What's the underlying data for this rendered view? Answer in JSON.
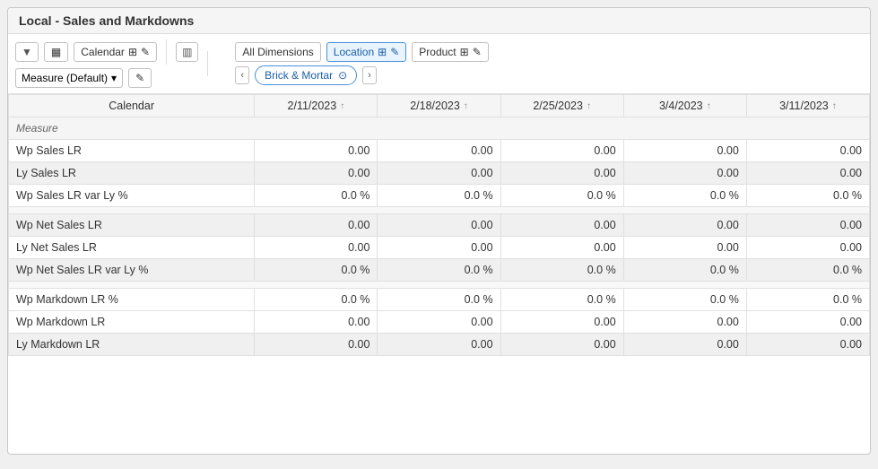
{
  "window": {
    "title": "Local - Sales and Markdowns"
  },
  "toolbar": {
    "collapse_label": "▼",
    "rows_icon_label": "☰",
    "calendar_label": "Calendar",
    "hierarchy_icon": "⊞",
    "edit_icon": "✎",
    "measure_label": "Measure (Default)",
    "dropdown_arrow": "▾",
    "all_dimensions_label": "All Dimensions",
    "location_label": "Location",
    "product_label": "Product",
    "brick_mortar_label": "Brick & Mortar",
    "nav_left": "‹",
    "nav_right": "›",
    "target_icon": "⊙",
    "rows_toggle": "▥"
  },
  "table": {
    "calendar_label": "Calendar",
    "measure_label": "Measure",
    "columns": [
      {
        "date": "2/11/2023"
      },
      {
        "date": "2/18/2023"
      },
      {
        "date": "2/25/2023"
      },
      {
        "date": "3/4/2023"
      },
      {
        "date": "3/11/2023"
      }
    ],
    "rows": [
      {
        "label": "Measure",
        "is_header": true,
        "values": [
          "",
          "",
          "",
          "",
          ""
        ]
      },
      {
        "label": "Wp Sales LR",
        "shaded": false,
        "values": [
          "0.00",
          "0.00",
          "0.00",
          "0.00",
          "0.00"
        ]
      },
      {
        "label": "Ly Sales LR",
        "shaded": true,
        "values": [
          "0.00",
          "0.00",
          "0.00",
          "0.00",
          "0.00"
        ]
      },
      {
        "label": "Wp Sales LR var Ly %",
        "shaded": false,
        "values": [
          "0.0 %",
          "0.0 %",
          "0.0 %",
          "0.0 %",
          "0.0 %"
        ]
      },
      {
        "label": "",
        "is_spacer": true,
        "shaded": false,
        "values": [
          "",
          "",
          "",
          "",
          ""
        ]
      },
      {
        "label": "Wp Net Sales LR",
        "shaded": true,
        "values": [
          "0.00",
          "0.00",
          "0.00",
          "0.00",
          "0.00"
        ]
      },
      {
        "label": "Ly Net Sales LR",
        "shaded": false,
        "values": [
          "0.00",
          "0.00",
          "0.00",
          "0.00",
          "0.00"
        ]
      },
      {
        "label": "Wp Net Sales LR var Ly %",
        "shaded": true,
        "values": [
          "0.0 %",
          "0.0 %",
          "0.0 %",
          "0.0 %",
          "0.0 %"
        ]
      },
      {
        "label": "",
        "is_spacer": true,
        "shaded": false,
        "values": [
          "",
          "",
          "",
          "",
          ""
        ]
      },
      {
        "label": "Wp Markdown LR %",
        "shaded": false,
        "values": [
          "0.0 %",
          "0.0 %",
          "0.0 %",
          "0.0 %",
          "0.0 %"
        ]
      },
      {
        "label": "Wp Markdown LR",
        "shaded": false,
        "values": [
          "0.00",
          "0.00",
          "0.00",
          "0.00",
          "0.00"
        ]
      },
      {
        "label": "Ly Markdown LR",
        "shaded": true,
        "values": [
          "0.00",
          "0.00",
          "0.00",
          "0.00",
          "0.00"
        ]
      }
    ]
  }
}
